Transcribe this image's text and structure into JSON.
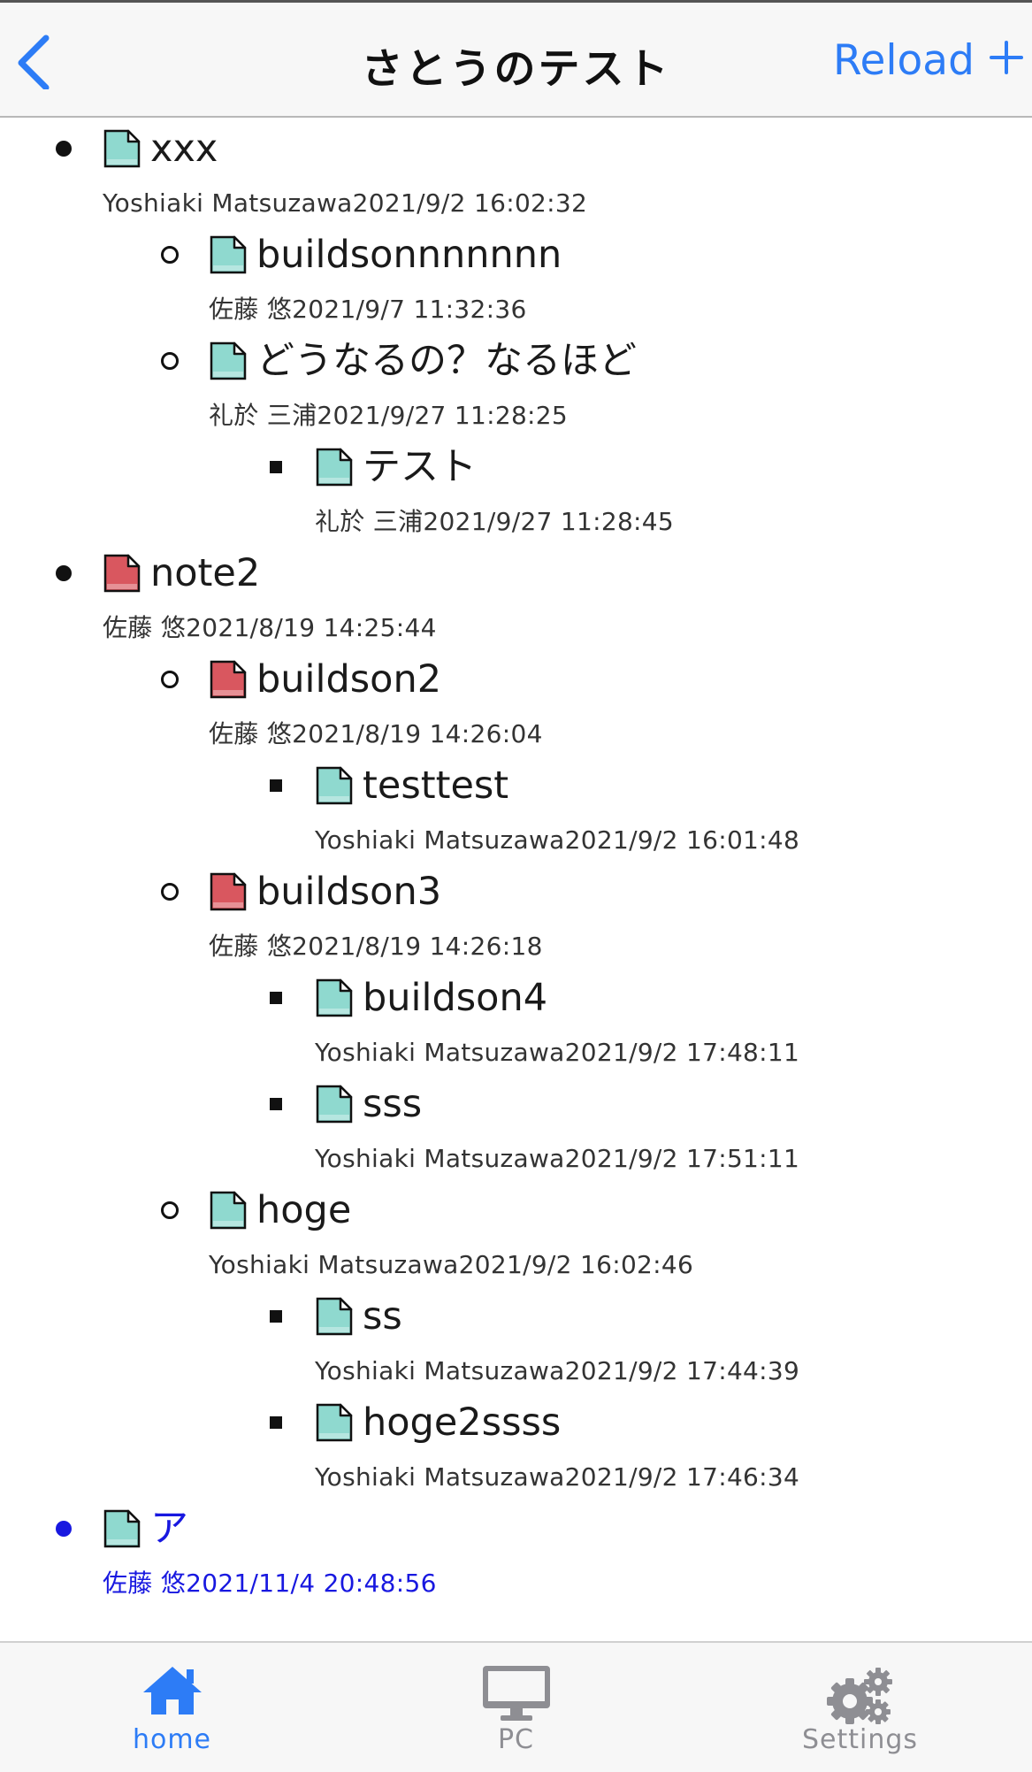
{
  "nav": {
    "title": "さとうのテスト",
    "reload_label": "Reload",
    "back_icon": "chevron-left-icon",
    "add_icon": "plus-icon"
  },
  "colors": {
    "accent": "#2d7cf6",
    "link": "#1818e0",
    "note_teal": "#8fd9cf",
    "note_red": "#d9575f",
    "text": "#1a1a1a",
    "meta_text": "#333333",
    "tab_inactive": "#8e8e93"
  },
  "tree": [
    {
      "title": "xxx",
      "meta": "Yoshiaki Matsuzawa2021/9/2 16:02:32",
      "icon": "document-teal-icon",
      "bullet": "disc",
      "children": [
        {
          "title": "buildsonnnnnnn",
          "meta": "佐藤 悠2021/9/7 11:32:36",
          "icon": "document-teal-icon",
          "bullet": "circle"
        },
        {
          "title": "どうなるの？なるほど",
          "meta": "礼於 三浦2021/9/27 11:28:25",
          "icon": "document-teal-icon",
          "bullet": "circle",
          "children": [
            {
              "title": "テスト",
              "meta": "礼於 三浦2021/9/27 11:28:45",
              "icon": "document-teal-icon",
              "bullet": "square"
            }
          ]
        }
      ]
    },
    {
      "title": "note2",
      "meta": "佐藤 悠2021/8/19 14:25:44",
      "icon": "document-red-icon",
      "bullet": "disc",
      "children": [
        {
          "title": "buildson2",
          "meta": "佐藤 悠2021/8/19 14:26:04",
          "icon": "document-red-icon",
          "bullet": "circle",
          "children": [
            {
              "title": "testtest",
              "meta": "Yoshiaki Matsuzawa2021/9/2 16:01:48",
              "icon": "document-teal-icon",
              "bullet": "square"
            }
          ]
        },
        {
          "title": "buildson3",
          "meta": "佐藤 悠2021/8/19 14:26:18",
          "icon": "document-red-icon",
          "bullet": "circle",
          "children": [
            {
              "title": "buildson4",
              "meta": "Yoshiaki Matsuzawa2021/9/2 17:48:11",
              "icon": "document-teal-icon",
              "bullet": "square"
            },
            {
              "title": "sss",
              "meta": "Yoshiaki Matsuzawa2021/9/2 17:51:11",
              "icon": "document-teal-icon",
              "bullet": "square"
            }
          ]
        },
        {
          "title": "hoge",
          "meta": "Yoshiaki Matsuzawa2021/9/2 16:02:46",
          "icon": "document-teal-icon",
          "bullet": "circle",
          "children": [
            {
              "title": "ss",
              "meta": "Yoshiaki Matsuzawa2021/9/2 17:44:39",
              "icon": "document-teal-icon",
              "bullet": "square"
            },
            {
              "title": "hoge2ssss",
              "meta": "Yoshiaki Matsuzawa2021/9/2 17:46:34",
              "icon": "document-teal-icon",
              "bullet": "square"
            }
          ]
        }
      ]
    },
    {
      "title": "ア",
      "meta": "佐藤 悠2021/11/4 20:48:56",
      "icon": "document-teal-icon",
      "bullet": "disc",
      "link": true
    }
  ],
  "tabbar": [
    {
      "label": "home",
      "icon": "home-icon",
      "active": true
    },
    {
      "label": "PC",
      "icon": "monitor-icon",
      "active": false
    },
    {
      "label": "Settings",
      "icon": "gears-icon",
      "active": false
    }
  ]
}
